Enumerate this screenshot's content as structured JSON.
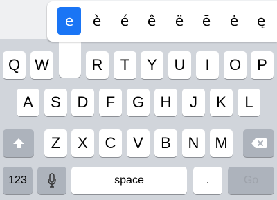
{
  "accent_popup": {
    "options": [
      "e",
      "è",
      "é",
      "ê",
      "ë",
      "ē",
      "ė",
      "ę"
    ],
    "selected_index": 0,
    "selected_color": "#1a75f5"
  },
  "rows": {
    "row1": [
      "Q",
      "W",
      "R",
      "T",
      "Y",
      "U",
      "I",
      "O",
      "P"
    ],
    "row2": [
      "A",
      "S",
      "D",
      "F",
      "G",
      "H",
      "J",
      "K",
      "L"
    ],
    "row3": [
      "Z",
      "X",
      "C",
      "V",
      "B",
      "N",
      "M"
    ]
  },
  "bottom_row": {
    "numbers_label": "123",
    "space_label": "space",
    "period_label": ".",
    "go_label": "Go"
  },
  "icons": {
    "shift": "shift-icon",
    "backspace": "backspace-icon",
    "dictation": "microphone-icon"
  }
}
